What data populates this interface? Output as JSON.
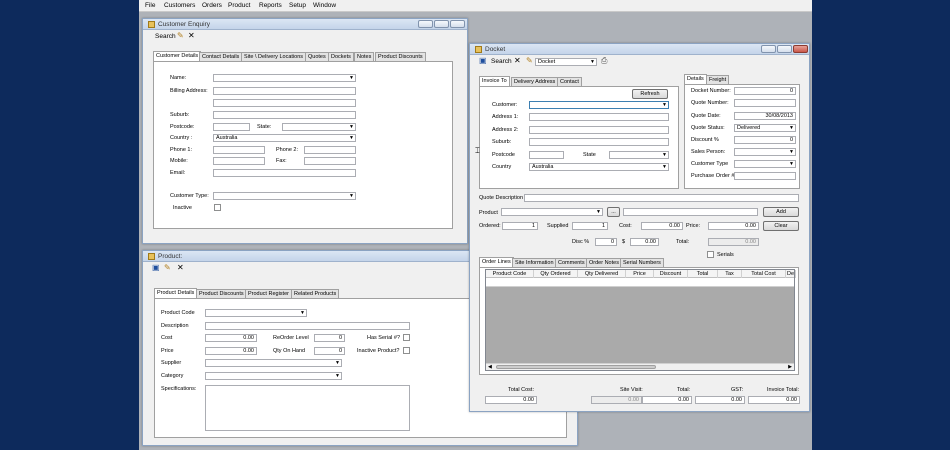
{
  "menu": [
    "File",
    "Customers",
    "Orders",
    "Product",
    "Reports",
    "Setup",
    "Window"
  ],
  "customer": {
    "title": "Customer Enquiry",
    "search": "Search",
    "tabs": [
      "Customer Details",
      "Contact Details",
      "Site \\ Delivery Locations",
      "Quotes",
      "Dockets",
      "Notes",
      "Product Discounts"
    ],
    "labels": {
      "name": "Name:",
      "billing": "Billing Address:",
      "suburb": "Suburb:",
      "postcode": "Postcode:",
      "state": "State:",
      "country": "Country :",
      "phone1": "Phone 1:",
      "phone2": "Phone 2:",
      "mobile": "Mobile:",
      "fax": "Fax:",
      "email": "Email:",
      "ctype": "Customer Type:",
      "inactive": "Inactive"
    },
    "country_value": "Australia"
  },
  "product": {
    "title": "Product:",
    "tabs": [
      "Product Details",
      "Product Discounts",
      "Product Register",
      "Related Products"
    ],
    "labels": {
      "code": "Product Code",
      "desc": "Description",
      "cost": "Cost",
      "price": "Price",
      "reorder": "ReOrder Level",
      "qoh": "Qty On Hand",
      "serial": "Has Serial #?",
      "inactive": "Inactive Product?",
      "supplier": "Supplier",
      "category": "Category",
      "specs": "Specifications:"
    },
    "values": {
      "cost": "0.00",
      "price": "0.00",
      "reorder": "0",
      "qoh": "0"
    }
  },
  "docket": {
    "title": "Docket",
    "search": "Search",
    "doc_type": "Docket",
    "left_tabs": [
      "Invoice To",
      "Delivery Address",
      "Contact"
    ],
    "right_tabs": [
      "Details",
      "Freight"
    ],
    "refresh": "Refresh",
    "labels": {
      "customer": "Customer:",
      "addr1": "Address 1:",
      "addr2": "Address 2:",
      "suburb": "Suburb:",
      "postcode": "Postcode",
      "state": "State",
      "country": "Country",
      "docket_no": "Docket Number:",
      "quote_no": "Quote Number:",
      "quote_date": "Quote Date:",
      "quote_status": "Quote Status:",
      "discount": "Discount %",
      "sales_person": "Sales Person:",
      "cust_type": "Customer Type",
      "po": "Purchase Order #",
      "quote_desc": "Quote Description",
      "product": "Product",
      "ordered": "Ordered:",
      "supplied": "Supplied",
      "cost": "Cost:",
      "price": "Price:",
      "disc": "Disc %",
      "dollar": "$",
      "total": "Total:",
      "serials": "Serials",
      "total_cost": "Total Cost:",
      "site_visit": "Site Visit:",
      "total2": "Total:",
      "gst": "GST:",
      "invoice_total": "Invoice Total:"
    },
    "values": {
      "country": "Australia",
      "docket_no": "0",
      "quote_date": "30/08/2013",
      "quote_status": "Delivered",
      "discount": "0",
      "ordered": "1",
      "supplied": "1",
      "cost": "0.00",
      "price": "0.00",
      "disc": "0",
      "disc_amt": "0.00",
      "total": "0.00",
      "total_cost": "0.00",
      "site_visit": "0.00",
      "total2": "0.00",
      "gst": "0.00",
      "invoice_total": "0.00",
      "browse": "..."
    },
    "add": "Add",
    "clear": "Clear",
    "grid_tabs": [
      "Order Lines",
      "Site Information",
      "Comments",
      "Order Notes",
      "Serial Numbers"
    ],
    "grid_cols": [
      "Product Code",
      "Qty Ordered",
      "Qty Delivered",
      "Price",
      "Discount",
      "Total",
      "Tax",
      "Total Cost",
      "De"
    ]
  }
}
